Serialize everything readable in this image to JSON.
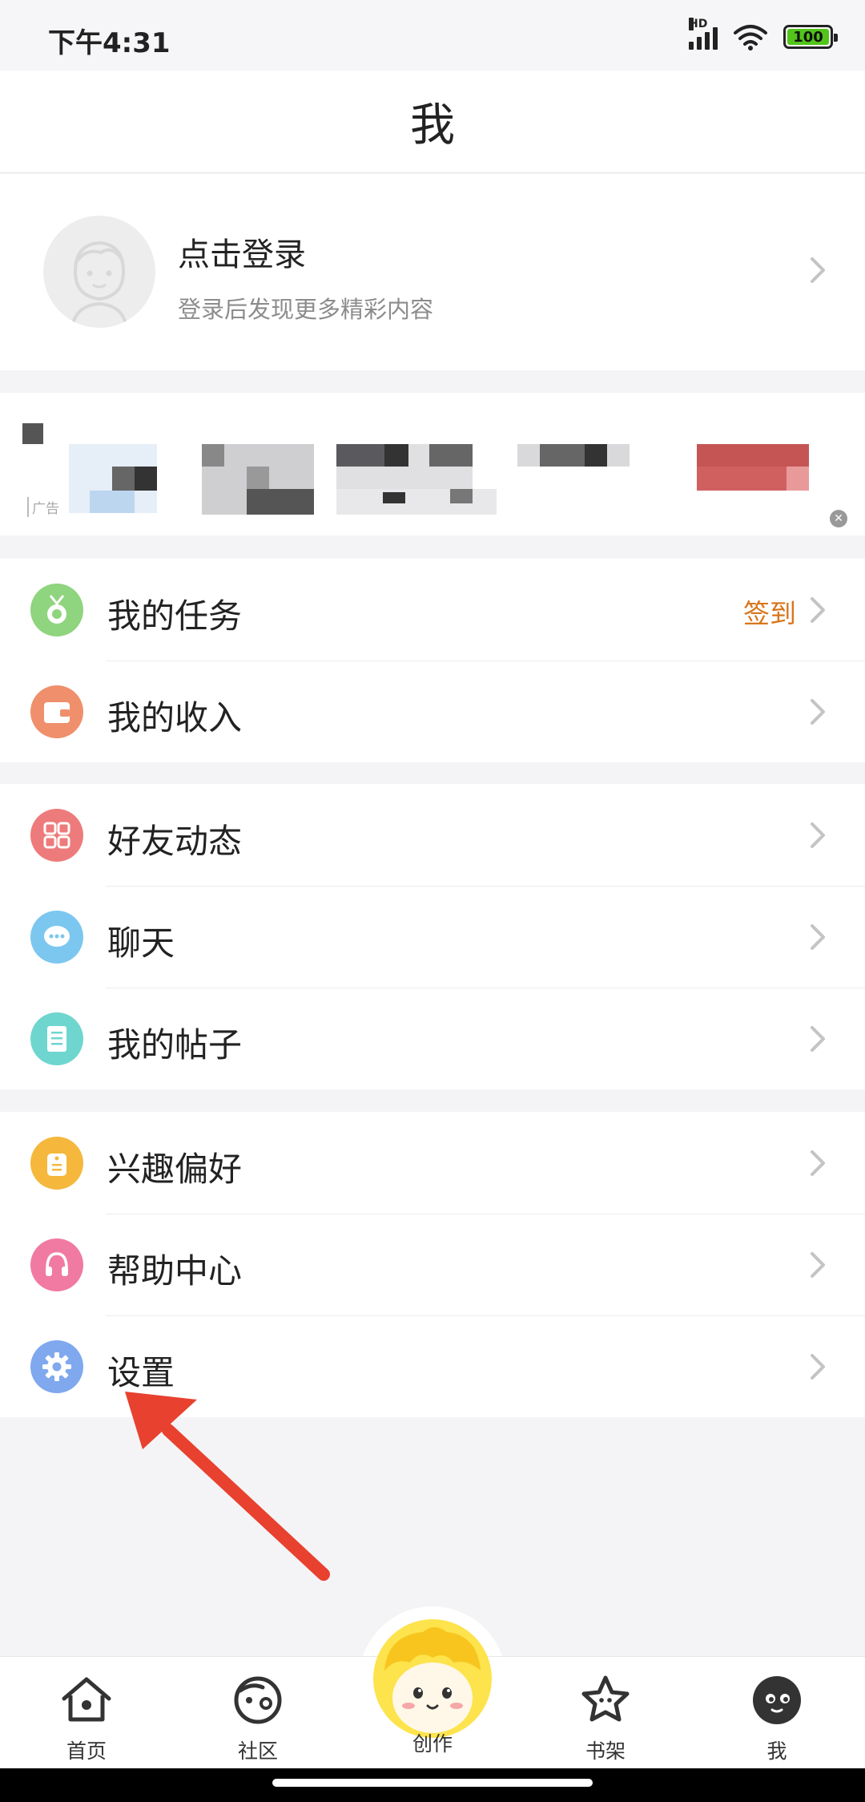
{
  "status_bar": {
    "time": "下午4:31",
    "network_label": "HD",
    "battery_level": "100"
  },
  "nav": {
    "title": "我"
  },
  "profile": {
    "title": "点击登录",
    "subtitle": "登录后发现更多精彩内容"
  },
  "ad": {
    "label": "广告"
  },
  "groups": [
    {
      "items": [
        {
          "label": "我的任务",
          "badge": "签到",
          "icon": "medal-icon",
          "color": "#8fd47e"
        },
        {
          "label": "我的收入",
          "icon": "wallet-icon",
          "color": "#ef8f6b"
        }
      ]
    },
    {
      "items": [
        {
          "label": "好友动态",
          "icon": "grid-icon",
          "color": "#ee7b7b"
        },
        {
          "label": "聊天",
          "icon": "chat-bubble-icon",
          "color": "#7cc7ef"
        },
        {
          "label": "我的帖子",
          "icon": "document-icon",
          "color": "#6fd6cf"
        }
      ]
    },
    {
      "items": [
        {
          "label": "兴趣偏好",
          "icon": "tag-icon",
          "color": "#f5b83d"
        },
        {
          "label": "帮助中心",
          "icon": "headphones-icon",
          "color": "#f07aa2"
        },
        {
          "label": "设置",
          "icon": "gear-icon",
          "color": "#7fa8ee"
        }
      ]
    }
  ],
  "bottom_nav": {
    "tabs": [
      {
        "label": "首页",
        "icon": "home-icon"
      },
      {
        "label": "社区",
        "icon": "community-icon"
      },
      {
        "label": "创作",
        "icon": "create-mascot-icon"
      },
      {
        "label": "书架",
        "icon": "star-bookshelf-icon"
      },
      {
        "label": "我",
        "icon": "profile-face-icon"
      }
    ],
    "active_tab": "我"
  },
  "colors": {
    "badge": "#d9741b",
    "annotation_arrow": "#e8412f",
    "create_button": "#fde34c"
  }
}
